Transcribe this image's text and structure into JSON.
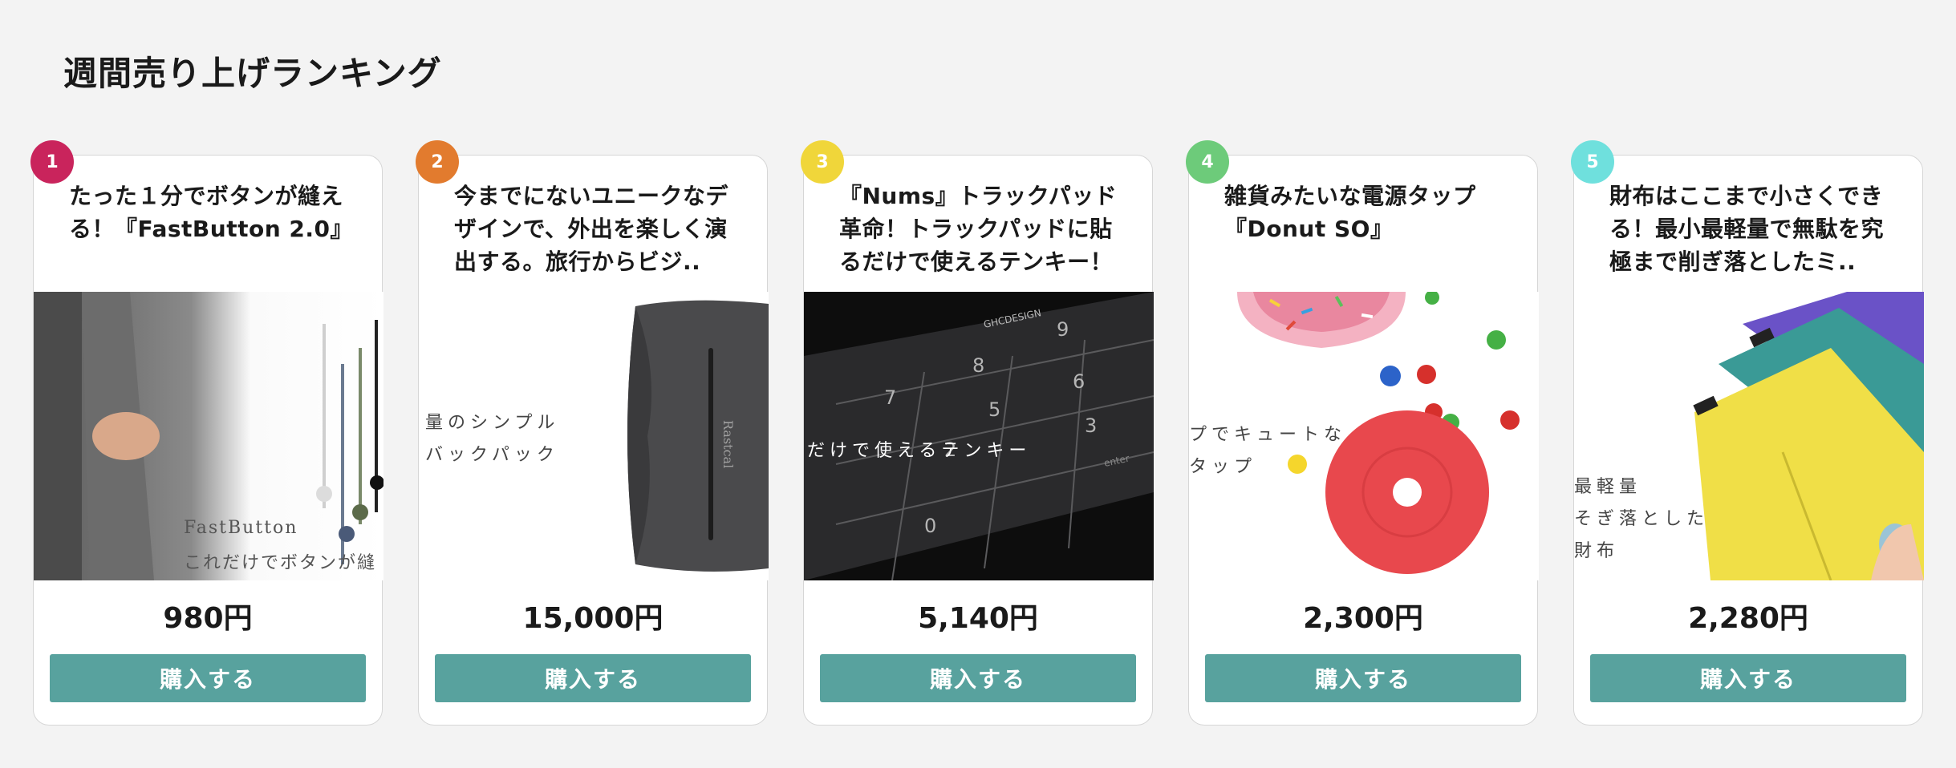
{
  "page": {
    "title": "週間売り上げランキング"
  },
  "buy_label": "購入する",
  "products": [
    {
      "rank": "1",
      "badge_color": "#c9245c",
      "title": "たった１分でボタンが縫える！『FastButton 2.0』",
      "price": "980円",
      "image_text": [
        "FastButton",
        "これだけでボタンが縫"
      ]
    },
    {
      "rank": "2",
      "badge_color": "#e27b2e",
      "title": "今までにないユニークなデザインで、外出を楽しく演出する。旅行からビジ..",
      "price": "15,000円",
      "image_text": [
        "量のシンプル",
        "バックパック"
      ]
    },
    {
      "rank": "3",
      "badge_color": "#f0d63a",
      "title": "『Nums』トラックパッド革命！トラックパッドに貼るだけで使えるテンキー！",
      "price": "5,140円",
      "image_text": [
        "だけで使えるテンキー"
      ]
    },
    {
      "rank": "4",
      "badge_color": "#6dcb7a",
      "title": "雑貨みたいな電源タップ『Donut SO』",
      "price": "2,300円",
      "image_text": [
        "プでキュートな",
        "タップ"
      ]
    },
    {
      "rank": "5",
      "badge_color": "#6fe0dd",
      "title": "財布はここまで小さくできる！最小最軽量で無駄を究極まで削ぎ落としたミ..",
      "price": "2,280円",
      "image_text": [
        "最軽量",
        "そぎ落とした",
        "財布"
      ]
    }
  ]
}
